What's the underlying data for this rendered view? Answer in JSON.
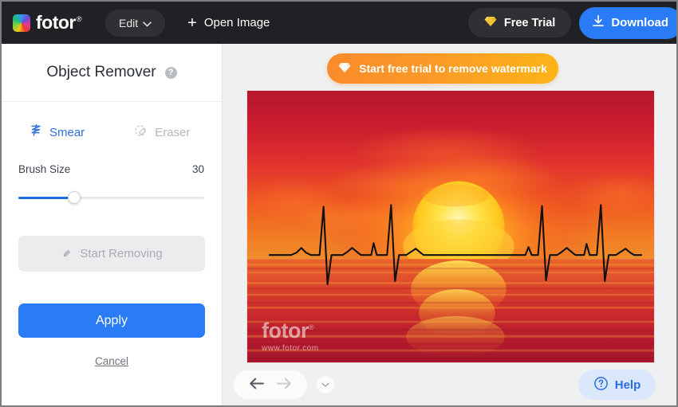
{
  "header": {
    "logo_text": "fotor",
    "logo_reg": "®",
    "logo_icon": "rainbow-color-wheel-icon",
    "edit_label": "Edit",
    "edit_chevron": "chevron-down-icon",
    "open_image_label": "Open Image",
    "open_image_icon": "plus-icon",
    "free_trial_label": "Free Trial",
    "free_trial_icon": "diamond-icon",
    "download_label": "Download",
    "download_icon": "download-arrow-icon",
    "accent_blue": "#2a7bf6",
    "bar_bg": "#202124"
  },
  "sidebar": {
    "panel_title": "Object Remover",
    "help_icon_glyph": "?",
    "tools": [
      {
        "label": "Smear",
        "icon": "smear-squiggle-icon",
        "active": true
      },
      {
        "label": "Eraser",
        "icon": "eraser-icon",
        "active": false
      }
    ],
    "brush": {
      "label": "Brush Size",
      "value": "30",
      "percent": 30,
      "min": 1,
      "max": 100
    },
    "start_removing_label": "Start Removing",
    "start_removing_icon": "eraser-icon",
    "start_removing_disabled": true,
    "apply_label": "Apply",
    "cancel_label": "Cancel"
  },
  "canvas": {
    "watermark_cta_label": "Start free trial to remove watermark",
    "watermark_cta_icon": "diamond-icon",
    "image": {
      "alt": "Sunset over ocean with black ECG heartbeat line",
      "watermark_text": "fotor",
      "watermark_reg": "®",
      "watermark_url": "www.fotor.com"
    },
    "toolbar": {
      "undo_icon": "arrow-left-icon",
      "undo_enabled": true,
      "redo_icon": "arrow-right-icon",
      "redo_enabled": false,
      "expand_icon": "chevron-down-icon",
      "help_label": "Help",
      "help_icon": "question-circle-icon"
    }
  }
}
